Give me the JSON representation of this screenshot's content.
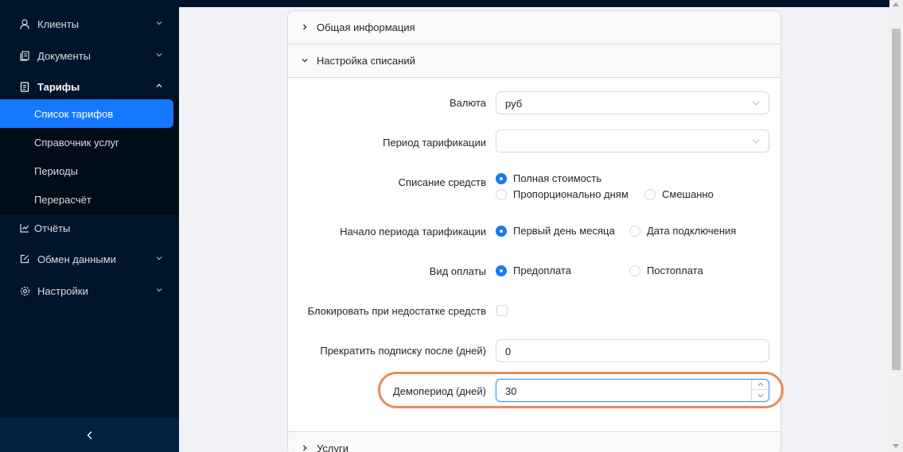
{
  "sidebar": {
    "items": [
      {
        "label": "Клиенты",
        "icon": "user-icon"
      },
      {
        "label": "Документы",
        "icon": "documents-icon"
      },
      {
        "label": "Тарифы",
        "icon": "tariffs-icon"
      },
      {
        "label": "Отчёты",
        "icon": "chart-line-icon"
      },
      {
        "label": "Обмен данными",
        "icon": "edit-square-icon"
      },
      {
        "label": "Настройки",
        "icon": "gear-icon"
      }
    ],
    "submenu": [
      {
        "label": "Список тарифов",
        "active": true
      },
      {
        "label": "Справочник услуг"
      },
      {
        "label": "Периоды"
      },
      {
        "label": "Перерасчёт"
      }
    ],
    "collapse_icon": "chevron-left-icon"
  },
  "panels": {
    "general": "Общая информация",
    "charges": "Настройка списаний",
    "services": "Услуги"
  },
  "form": {
    "currency_label": "Валюта",
    "currency_value": "руб",
    "period_label": "Период тарификации",
    "period_value": "",
    "charge_label": "Списание средств",
    "charge_options": [
      "Полная стоимость",
      "Пропорционально дням",
      "Смешанно"
    ],
    "charge_selected": "Полная стоимость",
    "start_label": "Начало периода тарификации",
    "start_options": [
      "Первый день месяца",
      "Дата подключения"
    ],
    "start_selected": "Первый день месяца",
    "payment_label": "Вид оплаты",
    "payment_options": [
      "Предоплата",
      "Постоплата"
    ],
    "payment_selected": "Предоплата",
    "block_label": "Блокировать при недостатке средств",
    "block_checked": false,
    "stop_label": "Прекратить подписку после (дней)",
    "stop_value": "0",
    "demo_label": "Демопериод (дней)",
    "demo_value": "30"
  },
  "colors": {
    "sidebar_bg": "#001529",
    "accent": "#1677ff",
    "highlight": "#ea8a5a"
  }
}
